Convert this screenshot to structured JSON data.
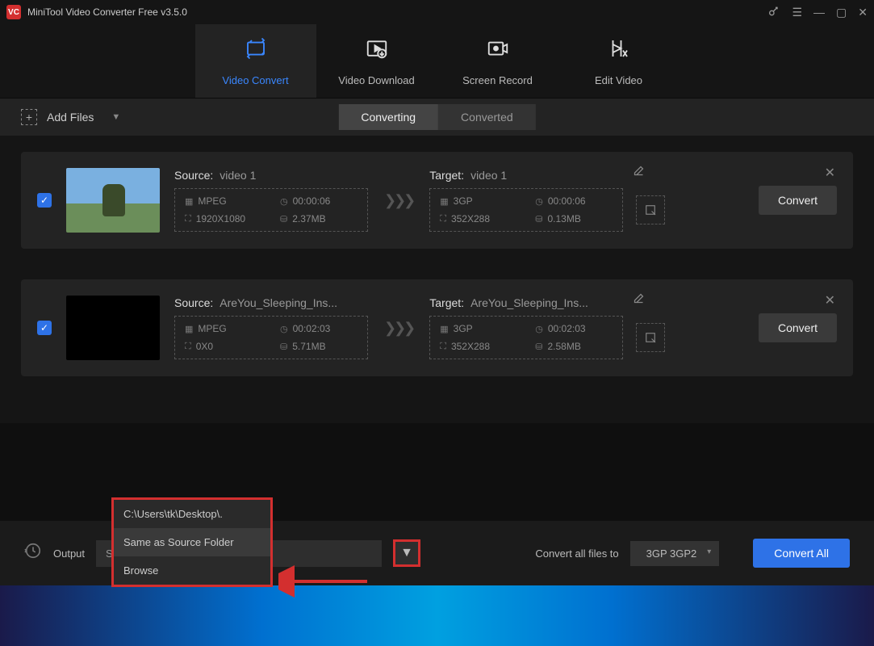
{
  "app": {
    "title": "MiniTool Video Converter Free v3.5.0",
    "icon_text": "VC"
  },
  "top_tabs": [
    {
      "label": "Video Convert"
    },
    {
      "label": "Video Download"
    },
    {
      "label": "Screen Record"
    },
    {
      "label": "Edit Video"
    }
  ],
  "toolbar": {
    "add_files": "Add Files"
  },
  "status_tabs": {
    "converting": "Converting",
    "converted": "Converted"
  },
  "cards": [
    {
      "source_label": "Source:",
      "source_name": "video 1",
      "src_format": "MPEG",
      "src_dur": "00:00:06",
      "src_res": "1920X1080",
      "src_size": "2.37MB",
      "target_label": "Target:",
      "target_name": "video 1",
      "tgt_format": "3GP",
      "tgt_dur": "00:00:06",
      "tgt_res": "352X288",
      "tgt_size": "0.13MB",
      "convert": "Convert"
    },
    {
      "source_label": "Source:",
      "source_name": "AreYou_Sleeping_Ins...",
      "src_format": "MPEG",
      "src_dur": "00:02:03",
      "src_res": "0X0",
      "src_size": "5.71MB",
      "target_label": "Target:",
      "target_name": "AreYou_Sleeping_Ins...",
      "tgt_format": "3GP",
      "tgt_dur": "00:02:03",
      "tgt_res": "352X288",
      "tgt_size": "2.58MB",
      "convert": "Convert"
    }
  ],
  "footer": {
    "output_label": "Output",
    "output_value": "Same as Source Folder",
    "convert_all_label": "Convert all files to",
    "format_value": "3GP 3GP2",
    "convert_all_btn": "Convert All"
  },
  "dropdown": {
    "items": [
      "C:\\Users\\tk\\Desktop\\.",
      "Same as Source Folder",
      "Browse"
    ]
  }
}
